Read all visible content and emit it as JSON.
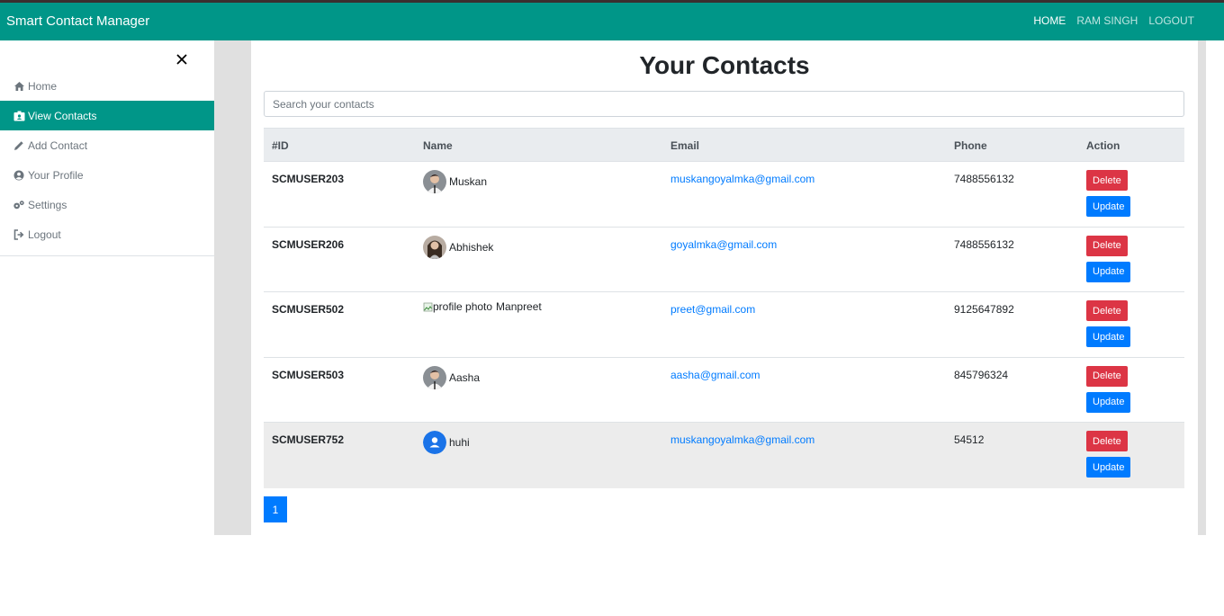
{
  "navbar": {
    "brand": "Smart Contact Manager",
    "links": [
      {
        "label": "HOME"
      },
      {
        "label": "RAM SINGH"
      },
      {
        "label": "LOGOUT"
      }
    ],
    "color": "#009688"
  },
  "sidebar": {
    "items": [
      {
        "label": "Home",
        "icon": "home-icon"
      },
      {
        "label": "View Contacts",
        "icon": "id-badge-icon"
      },
      {
        "label": "Add Contact",
        "icon": "pencil-icon"
      },
      {
        "label": "Your Profile",
        "icon": "user-circle-icon"
      },
      {
        "label": "Settings",
        "icon": "gears-icon"
      },
      {
        "label": "Logout",
        "icon": "sign-out-icon"
      }
    ]
  },
  "main": {
    "title": "Your Contacts",
    "search_placeholder": "Search your contacts",
    "columns": [
      "#ID",
      "Name",
      "Email",
      "Phone",
      "Action"
    ],
    "rows": [
      {
        "id": "SCMUSER203",
        "name": "Muskan",
        "email": "muskangoyalmka@gmail.com",
        "phone": "7488556132"
      },
      {
        "id": "SCMUSER206",
        "name": "Abhishek",
        "email": "goyalmka@gmail.com",
        "phone": "7488556132"
      },
      {
        "id": "SCMUSER502",
        "name": "Manpreet",
        "img_alt": "profile photo",
        "email": "preet@gmail.com",
        "phone": "9125647892"
      },
      {
        "id": "SCMUSER503",
        "name": "Aasha",
        "email": "aasha@gmail.com",
        "phone": "845796324"
      },
      {
        "id": "SCMUSER752",
        "name": "huhi",
        "email": "muskangoyalmka@gmail.com",
        "phone": "54512"
      }
    ],
    "delete_label": "Delete",
    "update_label": "Update",
    "page": "1"
  }
}
